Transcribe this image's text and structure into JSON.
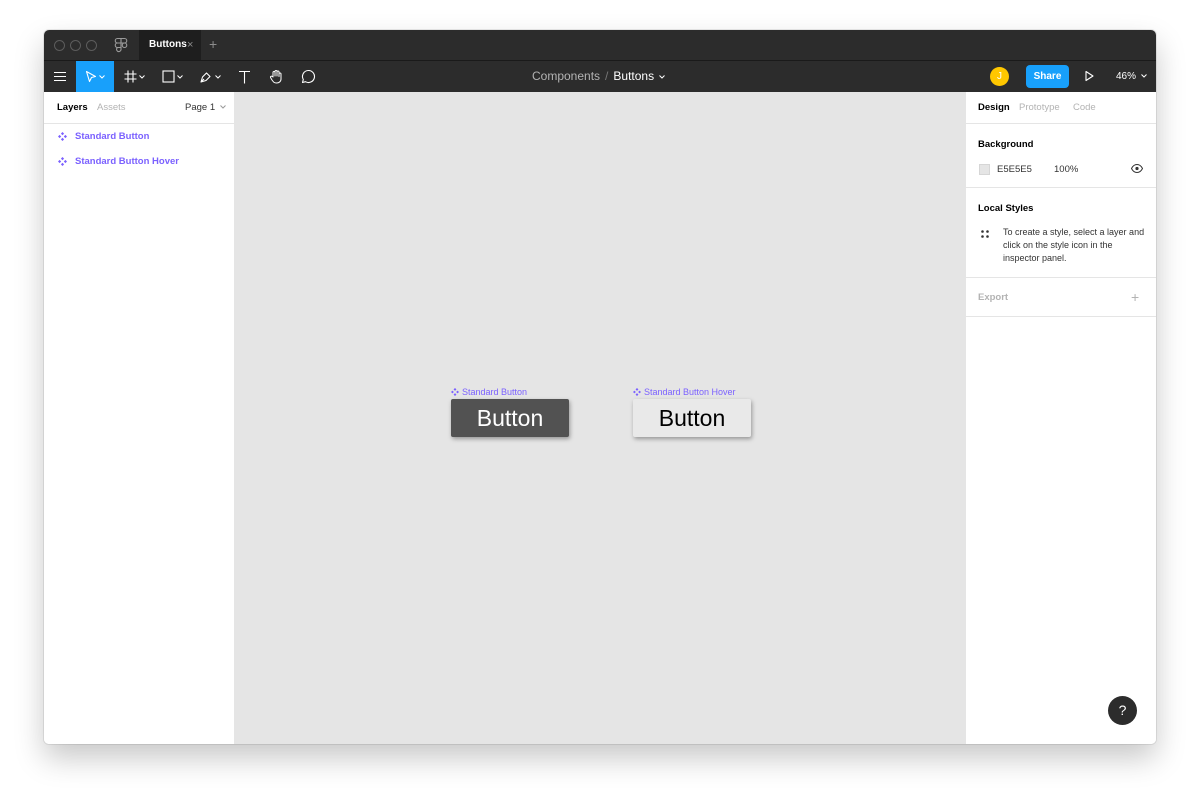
{
  "tab": {
    "title": "Buttons",
    "close": "×",
    "add": "+"
  },
  "breadcrumb": {
    "project": "Components",
    "separator": "/",
    "file": "Buttons"
  },
  "avatar": {
    "initial": "J",
    "color": "#ffc700"
  },
  "share_label": "Share",
  "zoom_label": "46%",
  "accent_color": "#18a0fb",
  "component_color": "#7b61ff",
  "left_panel": {
    "tabs": [
      "Layers",
      "Assets"
    ],
    "page_select": "Page 1",
    "layers": [
      {
        "name": "Standard Button",
        "icon": "component-icon"
      },
      {
        "name": "Standard Button Hover",
        "icon": "component-icon"
      }
    ]
  },
  "canvas": {
    "background": "#e5e5e5",
    "components": [
      {
        "label": "Standard Button",
        "button_text": "Button",
        "fill": "#525252"
      },
      {
        "label": "Standard Button Hover",
        "button_text": "Button",
        "fill": "#e9e9e9"
      }
    ]
  },
  "right_panel": {
    "tabs": [
      "Design",
      "Prototype",
      "Code"
    ],
    "background": {
      "title": "Background",
      "hex": "E5E5E5",
      "opacity": "100%"
    },
    "local_styles": {
      "title": "Local Styles",
      "hint": "To create a style, select a layer and click on the style icon in the inspector panel."
    },
    "export": {
      "title": "Export",
      "add": "+"
    }
  },
  "help_label": "?"
}
